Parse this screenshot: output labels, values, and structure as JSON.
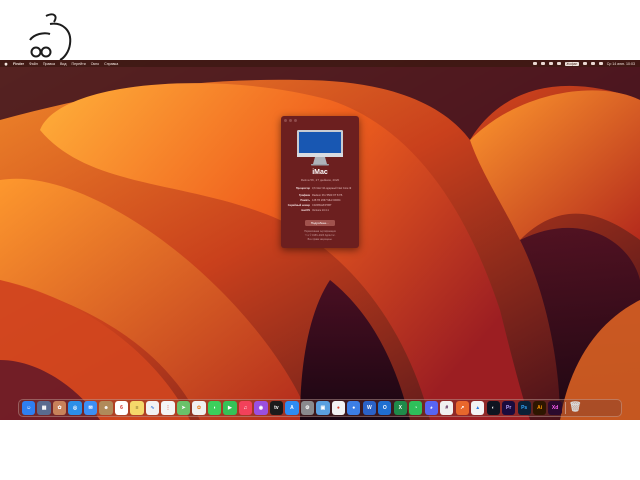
{
  "menubar": {
    "app_name": "Finder",
    "menus": [
      "Файл",
      "Правка",
      "Вид",
      "Перейти",
      "Окно",
      "Справка"
    ],
    "keyboard_layout": "Жофан",
    "clock": "Ср 14 июн. 10:03"
  },
  "about_window": {
    "model": "iMac",
    "subtitle": "Retina 5K, 27 дюймов, 2020",
    "specs": [
      {
        "key": "Процессор",
        "value": "3,6 GHz 10-ядерный Intel Core i9"
      },
      {
        "key": "Графика",
        "value": "Radeon Pro 5500 XT 8 ГБ"
      },
      {
        "key": "Память",
        "value": "128 ГБ 2667 MHz DDR4"
      },
      {
        "key": "Серийный номер",
        "value": "C02D5H2FPN5T"
      },
      {
        "key": "macOS",
        "value": "Ventura 13.4.1"
      }
    ],
    "more_info_label": "Подробнее…",
    "footer_lines": [
      "Нормативная сертификация",
      "™ и © 1983–2023 Apple Inc.",
      "Все права защищены."
    ]
  },
  "dock": {
    "items": [
      {
        "name": "finder",
        "color": "#2f7ff0",
        "glyph": "☺"
      },
      {
        "name": "launchpad",
        "color": "#5a6b8f",
        "glyph": "▦"
      },
      {
        "name": "photos-alt",
        "color": "#c8825a",
        "glyph": "✿"
      },
      {
        "name": "safari",
        "color": "#2c8fe8",
        "glyph": "◎"
      },
      {
        "name": "mail",
        "color": "#3d8ff5",
        "glyph": "✉"
      },
      {
        "name": "contacts",
        "color": "#b08a5a",
        "glyph": "☻"
      },
      {
        "name": "calendar",
        "color": "#ffffff",
        "glyph": "6",
        "fg": "#d0342c"
      },
      {
        "name": "notes",
        "color": "#f5d86a",
        "glyph": "≡",
        "fg": "#6b5a22"
      },
      {
        "name": "freeform",
        "color": "#f2f2f2",
        "glyph": "∿",
        "fg": "#3a78d8"
      },
      {
        "name": "reminders",
        "color": "#f4f4f4",
        "glyph": "⋮",
        "fg": "#e0452e"
      },
      {
        "name": "maps",
        "color": "#6ac26a",
        "glyph": "➤"
      },
      {
        "name": "photos",
        "color": "#f0f0f0",
        "glyph": "✿",
        "fg": "#e8872c"
      },
      {
        "name": "messages",
        "color": "#3ccf5c",
        "glyph": "◖"
      },
      {
        "name": "facetime",
        "color": "#36c257",
        "glyph": "▶"
      },
      {
        "name": "music",
        "color": "#f2415a",
        "glyph": "♫"
      },
      {
        "name": "podcasts",
        "color": "#9b4fe0",
        "glyph": "◉"
      },
      {
        "name": "tv",
        "color": "#1b1b1b",
        "glyph": "tv"
      },
      {
        "name": "app-store",
        "color": "#2f8cf2",
        "glyph": "A"
      },
      {
        "name": "system-settings",
        "color": "#8a8a8e",
        "glyph": "⚙"
      },
      {
        "name": "preview",
        "color": "#5aa0e0",
        "glyph": "▣"
      },
      {
        "name": "chrome",
        "color": "#f2f2f2",
        "glyph": "●",
        "fg": "#d9432f"
      },
      {
        "name": "chrome-2",
        "color": "#3c7ee6",
        "glyph": "●"
      },
      {
        "name": "word",
        "color": "#2b62c7",
        "glyph": "W"
      },
      {
        "name": "outlook",
        "color": "#1f6fd0",
        "glyph": "O"
      },
      {
        "name": "excel",
        "color": "#1f8a4a",
        "glyph": "X"
      },
      {
        "name": "whatsapp",
        "color": "#2fbf5a",
        "glyph": "◔"
      },
      {
        "name": "discord",
        "color": "#5865f2",
        "glyph": "◕"
      },
      {
        "name": "slack",
        "color": "#f0f0f0",
        "glyph": "#",
        "fg": "#4a154b"
      },
      {
        "name": "illustrator-clone",
        "color": "#e8672c",
        "glyph": "↗"
      },
      {
        "name": "google-ads",
        "color": "#f3f3f3",
        "glyph": "▲",
        "fg": "#2c7be5"
      },
      {
        "name": "zoom-cam",
        "color": "#101420",
        "glyph": "◐"
      },
      {
        "name": "premiere-pro",
        "color": "#1a0b3d",
        "glyph": "Pr",
        "fg": "#b9a6ff"
      },
      {
        "name": "photoshop",
        "color": "#0b2036",
        "glyph": "Ps",
        "fg": "#33a8ff"
      },
      {
        "name": "illustrator",
        "color": "#2e1600",
        "glyph": "Ai",
        "fg": "#ff9a00"
      },
      {
        "name": "xd",
        "color": "#2b0a2e",
        "glyph": "Xd",
        "fg": "#ff61f6"
      }
    ],
    "trash": {
      "name": "trash",
      "glyph": "🗑"
    }
  }
}
